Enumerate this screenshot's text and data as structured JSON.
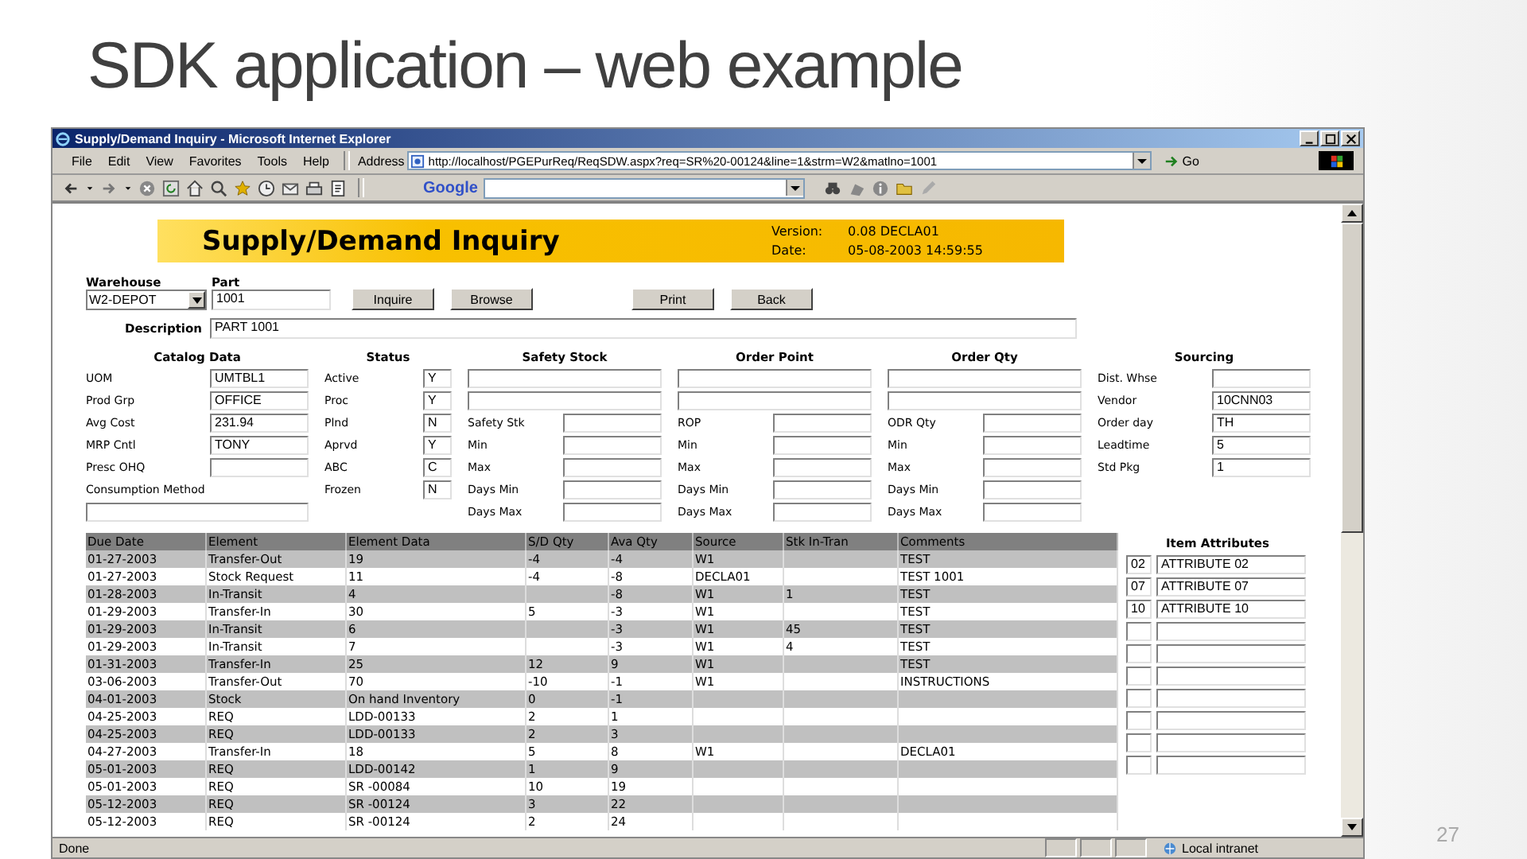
{
  "slide": {
    "title": "SDK application – web example",
    "page_number": "27"
  },
  "window": {
    "title": "Supply/Demand Inquiry - Microsoft Internet Explorer"
  },
  "menu": [
    "File",
    "Edit",
    "View",
    "Favorites",
    "Tools",
    "Help"
  ],
  "address_bar": {
    "label": "Address",
    "url": "http://localhost/PGEPurReq/ReqSDW.aspx?req=SR%20-00124&line=1&strm=W2&matlno=1001",
    "go": "Go"
  },
  "toolbar": {
    "search_brand": "Google"
  },
  "banner": {
    "title": "Supply/Demand Inquiry",
    "version_label": "Version:",
    "version": "0.08 DECLA01",
    "date_label": "Date:",
    "date": "05-08-2003 14:59:55"
  },
  "form": {
    "warehouse_label": "Warehouse",
    "warehouse": "W2-DEPOT",
    "part_label": "Part",
    "part": "1001",
    "buttons": [
      "Inquire",
      "Browse",
      "Print",
      "Back"
    ],
    "description_label": "Description",
    "description": "PART 1001"
  },
  "sections": [
    {
      "title": "Catalog Data",
      "rows": [
        {
          "kind": "field",
          "label": "UOM",
          "value": "UMTBL1"
        },
        {
          "kind": "field",
          "label": "Prod Grp",
          "value": "OFFICE"
        },
        {
          "kind": "field",
          "label": "Avg Cost",
          "value": "231.94"
        },
        {
          "kind": "field",
          "label": "MRP Cntl",
          "value": "TONY"
        },
        {
          "kind": "field",
          "label": "Presc OHQ"
        },
        {
          "kind": "label",
          "label": "Consumption Method"
        },
        {
          "kind": "wide"
        }
      ]
    },
    {
      "title": "Status",
      "rows": [
        {
          "kind": "field",
          "label": "Active",
          "value": "Y"
        },
        {
          "kind": "field",
          "label": "Proc",
          "value": "Y"
        },
        {
          "kind": "field",
          "label": "Plnd",
          "value": "N"
        },
        {
          "kind": "field",
          "label": "Aprvd",
          "value": "Y"
        },
        {
          "kind": "field",
          "label": "ABC",
          "value": "C"
        },
        {
          "kind": "field",
          "label": "Frozen",
          "value": "N"
        }
      ]
    },
    {
      "title": "Safety Stock",
      "rows": [
        {
          "kind": "wide"
        },
        {
          "kind": "wide"
        },
        {
          "kind": "field",
          "label": "Safety Stk"
        },
        {
          "kind": "field",
          "label": "Min"
        },
        {
          "kind": "field",
          "label": "Max"
        },
        {
          "kind": "field",
          "label": "Days Min"
        },
        {
          "kind": "field",
          "label": "Days Max"
        }
      ]
    },
    {
      "title": "Order Point",
      "rows": [
        {
          "kind": "wide"
        },
        {
          "kind": "wide"
        },
        {
          "kind": "field",
          "label": "ROP"
        },
        {
          "kind": "field",
          "label": "Min"
        },
        {
          "kind": "field",
          "label": "Max"
        },
        {
          "kind": "field",
          "label": "Days Min"
        },
        {
          "kind": "field",
          "label": "Days Max"
        }
      ]
    },
    {
      "title": "Order Qty",
      "rows": [
        {
          "kind": "wide"
        },
        {
          "kind": "wide"
        },
        {
          "kind": "field",
          "label": "ODR Qty"
        },
        {
          "kind": "field",
          "label": "Min"
        },
        {
          "kind": "field",
          "label": "Max"
        },
        {
          "kind": "field",
          "label": "Days Min"
        },
        {
          "kind": "field",
          "label": "Days Max"
        }
      ]
    },
    {
      "title": "Sourcing",
      "rows": [
        {
          "kind": "field",
          "label": "Dist. Whse"
        },
        {
          "kind": "field",
          "label": "Vendor",
          "value": "10CNN03"
        },
        {
          "kind": "field",
          "label": "Order day",
          "value": "TH"
        },
        {
          "kind": "field",
          "label": "Leadtime",
          "value": "5"
        },
        {
          "kind": "field",
          "label": "Std Pkg",
          "value": "1"
        }
      ]
    }
  ],
  "table": {
    "columns": [
      "Due Date",
      "Element",
      "Element Data",
      "S/D Qty",
      "Ava Qty",
      "Source",
      "Stk In-Tran",
      "Comments"
    ],
    "rows": [
      {
        "due_date": "01-27-2003",
        "element": "Transfer-Out",
        "element_data": "19",
        "sd_qty": "-4",
        "ava_qty": "-4",
        "source": "W1",
        "comments": "TEST"
      },
      {
        "due_date": "01-27-2003",
        "element": "Stock Request",
        "element_data": "11",
        "sd_qty": "-4",
        "ava_qty": "-8",
        "source": "DECLA01",
        "comments": "TEST 1001"
      },
      {
        "due_date": "01-28-2003",
        "element": "In-Transit",
        "element_data": "4",
        "ava_qty": "-8",
        "source": "W1",
        "stk_in_tran": "1",
        "comments": "TEST"
      },
      {
        "due_date": "01-29-2003",
        "element": "Transfer-In",
        "element_data": "30",
        "sd_qty": "5",
        "ava_qty": "-3",
        "source": "W1",
        "comments": "TEST"
      },
      {
        "due_date": "01-29-2003",
        "element": "In-Transit",
        "element_data": "6",
        "ava_qty": "-3",
        "source": "W1",
        "stk_in_tran": "45",
        "comments": "TEST"
      },
      {
        "due_date": "01-29-2003",
        "element": "In-Transit",
        "element_data": "7",
        "ava_qty": "-3",
        "source": "W1",
        "stk_in_tran": "4",
        "comments": "TEST"
      },
      {
        "due_date": "01-31-2003",
        "element": "Transfer-In",
        "element_data": "25",
        "sd_qty": "12",
        "ava_qty": "9",
        "source": "W1",
        "comments": "TEST"
      },
      {
        "due_date": "03-06-2003",
        "element": "Transfer-Out",
        "element_data": "70",
        "sd_qty": "-10",
        "ava_qty": "-1",
        "source": "W1",
        "comments": "INSTRUCTIONS"
      },
      {
        "due_date": "04-01-2003",
        "element": "Stock",
        "element_data": "On hand Inventory",
        "sd_qty": "0",
        "ava_qty": "-1"
      },
      {
        "due_date": "04-25-2003",
        "element": "REQ",
        "element_data": "LDD-00133",
        "sd_qty": "2",
        "ava_qty": "1"
      },
      {
        "due_date": "04-25-2003",
        "element": "REQ",
        "element_data": "LDD-00133",
        "sd_qty": "2",
        "ava_qty": "3"
      },
      {
        "due_date": "04-27-2003",
        "element": "Transfer-In",
        "element_data": "18",
        "sd_qty": "5",
        "ava_qty": "8",
        "source": "W1",
        "comments": "DECLA01"
      },
      {
        "due_date": "05-01-2003",
        "element": "REQ",
        "element_data": "LDD-00142",
        "sd_qty": "1",
        "ava_qty": "9"
      },
      {
        "due_date": "05-01-2003",
        "element": "REQ",
        "element_data": "SR -00084",
        "sd_qty": "10",
        "ava_qty": "19"
      },
      {
        "due_date": "05-12-2003",
        "element": "REQ",
        "element_data": "SR -00124",
        "sd_qty": "3",
        "ava_qty": "22"
      },
      {
        "due_date": "05-12-2003",
        "element": "REQ",
        "element_data": "SR -00124",
        "sd_qty": "2",
        "ava_qty": "24"
      }
    ]
  },
  "item_attributes": {
    "title": "Item Attributes",
    "rows": [
      {
        "code": "02",
        "text": "ATTRIBUTE 02"
      },
      {
        "code": "07",
        "text": "ATTRIBUTE 07"
      },
      {
        "code": "10",
        "text": "ATTRIBUTE 10"
      },
      {},
      {},
      {},
      {},
      {},
      {},
      {}
    ]
  },
  "status_bar": {
    "status": "Done",
    "zone": "Local intranet"
  }
}
